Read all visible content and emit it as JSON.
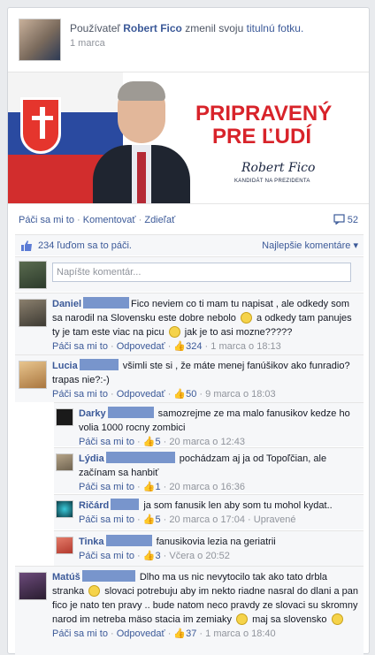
{
  "header": {
    "prefix": "Používateľ",
    "author": "Robert Fico",
    "verb": "zmenil svoju",
    "object": "titulnú fotku.",
    "date": "1 marca"
  },
  "cover": {
    "slogan_line1": "PRIPRAVENÝ",
    "slogan_line2": "PRE ĽUDÍ",
    "signature": "Robert Fico",
    "caption": "KANDIDÁT NA PREZIDENTA"
  },
  "actions": {
    "like": "Páči sa mi to",
    "comment": "Komentovať",
    "share": "Zdieľať",
    "comment_count": "52"
  },
  "likebar": {
    "likes": "234 ľuďom sa to páči.",
    "sort": "Najlepšie komentáre ▾"
  },
  "compose": {
    "placeholder": "Napíšte komentár..."
  },
  "comments": [
    {
      "name": "Daniel",
      "text1": "Fico neviem co ti mam tu napisat , ale odkedy som sa narodil na Slovensku este dobre nebolo",
      "text2": "a odkedy tam panujes ty je tam este viac na picu",
      "text3": "jak je to asi mozne?????",
      "like": "Páči sa mi to",
      "reply": "Odpovedať",
      "count": "324",
      "date": "1 marca o 18:13"
    },
    {
      "name": "Lucia",
      "text1": "všimli ste si , že máte menej fanúšikov ako funradio? trapas nie?:-)",
      "like": "Páči sa mi to",
      "reply": "Odpovedať",
      "count": "50",
      "date": "9 marca o 18:03"
    },
    {
      "name": "Matúš",
      "text1": "Dlho ma us nic nevytocilo tak ako tato drbla stranka",
      "text2": "slovaci potrebuju aby im nekto riadne nasral do dlani a pan fico je nato ten pravy .. bude natom neco pravdy ze slovaci su skromny narod im netreba mäso stacia im zemiaky",
      "text3": "maj sa slovensko",
      "like": "Páči sa mi to",
      "reply": "Odpovedať",
      "count": "37",
      "date": "1 marca o 18:40"
    }
  ],
  "replies": [
    {
      "name": "Darky",
      "text": "samozrejme ze ma malo fanusikov kedze ho volia 1000 rocny zombici",
      "like": "Páči sa mi to",
      "count": "5",
      "date": "20 marca o 12:43"
    },
    {
      "name": "Lýdia",
      "text": "pochádzam aj ja od Topoľčian, ale začínam sa hanbiť",
      "like": "Páči sa mi to",
      "count": "1",
      "date": "20 marca o 16:36"
    },
    {
      "name": "Ričárd",
      "text": "ja som fanusik len aby som tu mohol kydat..",
      "like": "Páči sa mi to",
      "count": "5",
      "date": "20 marca o 17:04",
      "edited": "Upravené"
    },
    {
      "name": "Tinka",
      "text": "fanusikovia lezia na geriatrii",
      "like": "Páči sa mi to",
      "count": "3",
      "date": "Včera o 20:52"
    }
  ]
}
